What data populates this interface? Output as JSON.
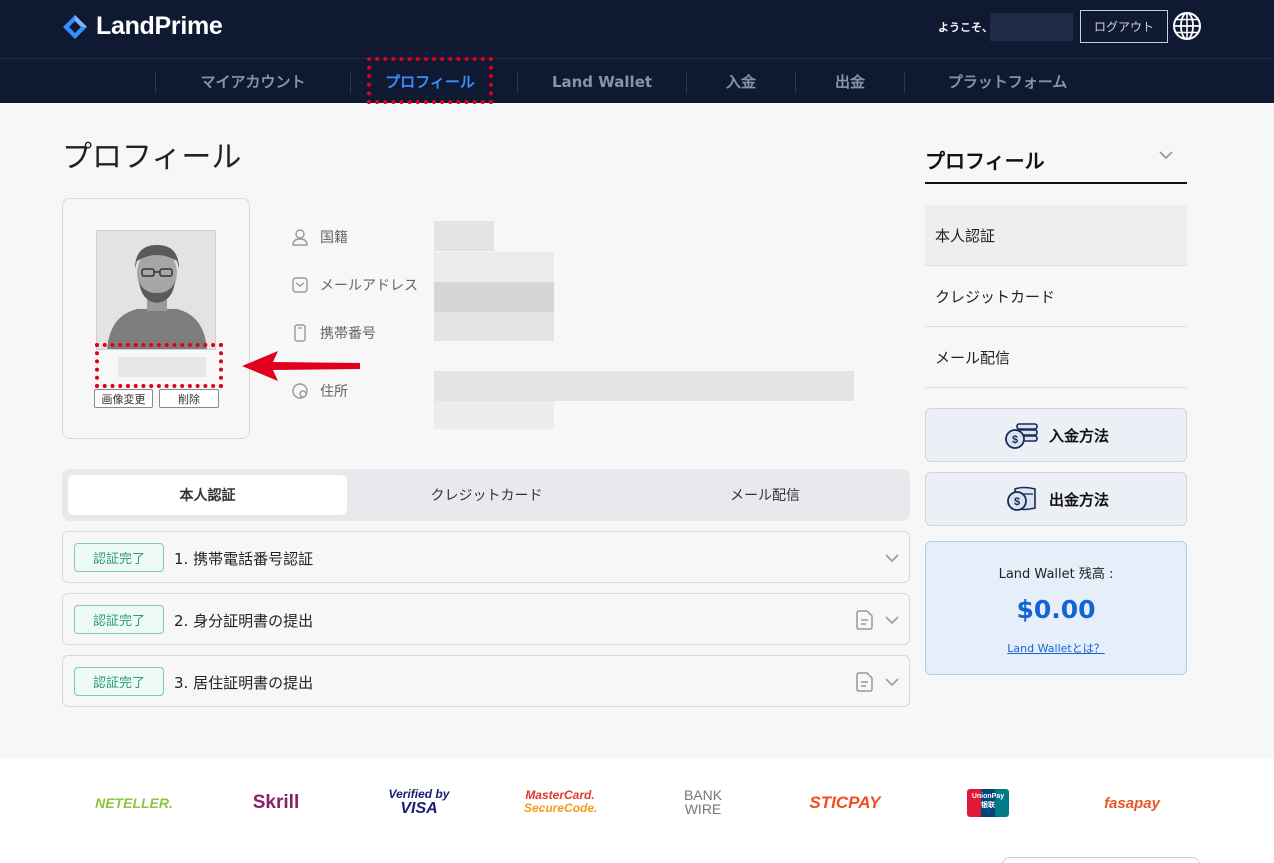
{
  "header": {
    "brand": "LandPrime",
    "welcome": "ようこそ、",
    "logout_label": "ログアウト"
  },
  "nav": {
    "items": [
      {
        "label": "マイアカウント"
      },
      {
        "label": "プロフィール"
      },
      {
        "label": "Land Wallet"
      },
      {
        "label": "入金"
      },
      {
        "label": "出金"
      },
      {
        "label": "プラットフォーム"
      }
    ],
    "active_index": 1
  },
  "main": {
    "title": "プロフィール",
    "avatar": {
      "change_label": "画像変更",
      "delete_label": "削除"
    },
    "fields": [
      {
        "label": "国籍",
        "icon": "person-icon"
      },
      {
        "label": "メールアドレス",
        "icon": "mail-icon"
      },
      {
        "label": "携帯番号",
        "icon": "phone-icon"
      },
      {
        "label": "住所",
        "icon": "location-icon"
      }
    ],
    "tabs": [
      {
        "label": "本人認証"
      },
      {
        "label": "クレジットカード"
      },
      {
        "label": "メール配信"
      }
    ],
    "verifications": [
      {
        "status": "認証完了",
        "label": "1. 携帯電話番号認証",
        "has_doc_icon": false
      },
      {
        "status": "認証完了",
        "label": "2. 身分証明書の提出",
        "has_doc_icon": true
      },
      {
        "status": "認証完了",
        "label": "3. 居住証明書の提出",
        "has_doc_icon": true
      }
    ]
  },
  "sidebar": {
    "title": "プロフィール",
    "items": [
      {
        "label": "本人認証"
      },
      {
        "label": "クレジットカード"
      },
      {
        "label": "メール配信"
      }
    ],
    "deposit_label": "入金方法",
    "withdraw_label": "出金方法",
    "wallet": {
      "label": "Land Wallet 残高 :",
      "amount": "$0.00",
      "link": "Land Walletとは？"
    }
  },
  "footer": {
    "payments": [
      "NETELLER.",
      "Skrill",
      "Verified by",
      "VISA",
      "MasterCard.",
      "SecureCode.",
      "BANK",
      "WIRE",
      "STICPAY",
      "UnionPay",
      "银联",
      "fasapay"
    ]
  },
  "colors": {
    "header_bg": "#0f1a32",
    "accent": "#3a8cff",
    "success": "#2e9b78",
    "wallet_amount": "#1464d6",
    "highlight": "#e0001b"
  }
}
